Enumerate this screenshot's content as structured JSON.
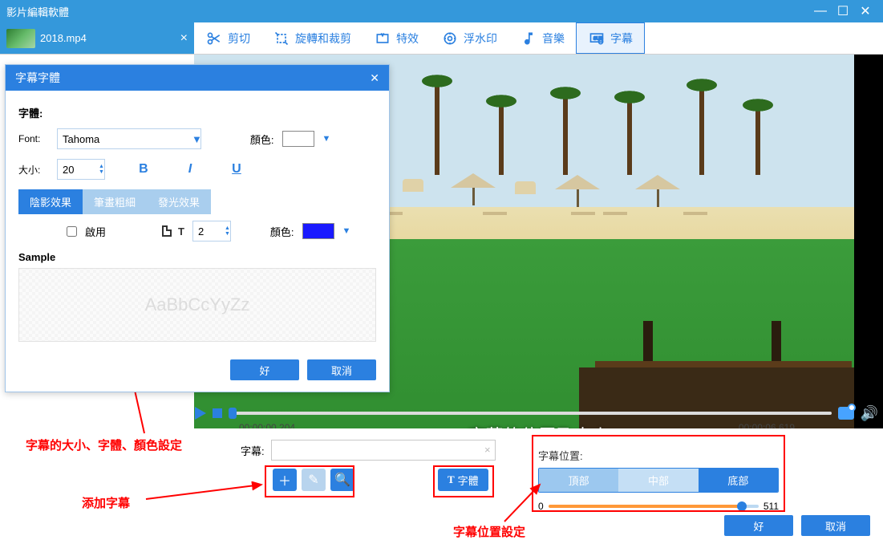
{
  "app": {
    "title": "影片編輯軟體"
  },
  "file": {
    "name": "2018.mp4"
  },
  "toolbar": {
    "cut": "剪切",
    "rotate": "旋轉和裁剪",
    "effect": "特效",
    "watermark": "浮水印",
    "music": "音樂",
    "subtitle": "字幕"
  },
  "preview": {
    "caption": "字幕的位置及大小"
  },
  "play": {
    "start_time": "00:00:00.204",
    "end_time": "00:00:06.619"
  },
  "subtitle_panel": {
    "label": "字幕:",
    "font_button": "字體",
    "position_label": "字幕位置:",
    "pos_top": "頂部",
    "pos_mid": "中部",
    "pos_bot": "底部",
    "slider_min": "0",
    "slider_val": "511"
  },
  "buttons": {
    "ok": "好",
    "cancel": "取消"
  },
  "annotations": {
    "a1": "字幕的大小、字體、顏色設定",
    "a2": "添加字幕",
    "a3": "字幕位置設定"
  },
  "dialog": {
    "title": "字幕字體",
    "section_font": "字體:",
    "font_label": "Font:",
    "font_value": "Tahoma",
    "color_label": "顏色:",
    "size_label": "大小:",
    "size_value": "20",
    "tab_shadow": "陰影效果",
    "tab_stroke": "筆畫粗細",
    "tab_glow": "發光效果",
    "enable": "啟用",
    "stroke_val": "2",
    "sample_label": "Sample",
    "sample_text": "AaBbCcYyZz",
    "ok": "好",
    "cancel": "取消",
    "shadow_color": "#1a1aff",
    "font_color": "#ffffff"
  }
}
